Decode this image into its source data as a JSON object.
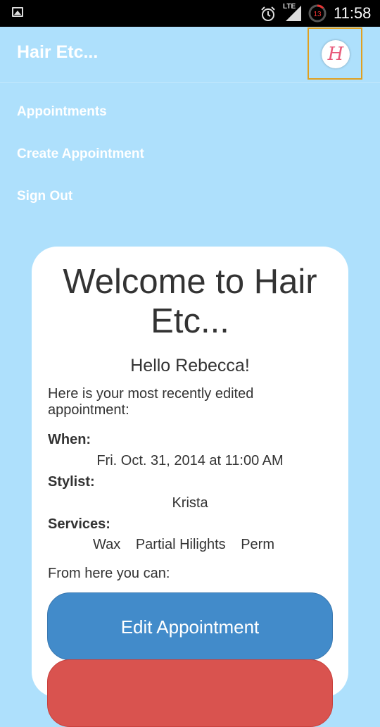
{
  "status_bar": {
    "network": "LTE",
    "battery_level": "13",
    "time": "11:58"
  },
  "app": {
    "title": "Hair Etc...",
    "logo_letter": "H"
  },
  "nav": {
    "items": [
      "Appointments",
      "Create Appointment",
      "Sign Out"
    ]
  },
  "card": {
    "welcome": "Welcome to Hair Etc...",
    "greeting": "Hello Rebecca!",
    "intro": "Here is your most recently edited appointment:",
    "when_label": "When:",
    "when_value": "Fri. Oct. 31, 2014 at 11:00 AM",
    "stylist_label": "Stylist:",
    "stylist_value": "Krista",
    "services_label": "Services:",
    "services": [
      "Wax",
      "Partial Hilights",
      "Perm"
    ],
    "from_here": "From here you can:",
    "edit_button": "Edit Appointment",
    "delete_button": ""
  },
  "colors": {
    "background": "#aee0fc",
    "edit_button": "#428bca",
    "delete_button": "#d9534f",
    "logo_border": "#e0a020"
  }
}
